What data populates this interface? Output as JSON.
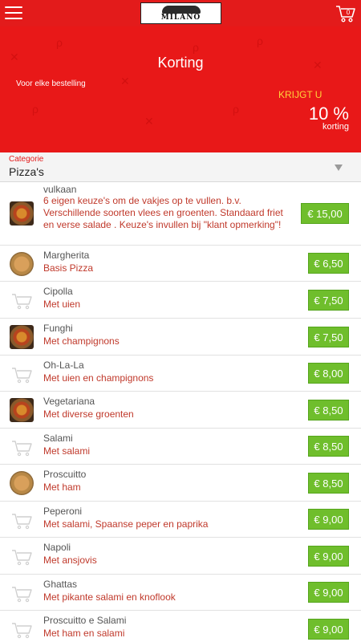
{
  "header": {
    "menu_icon": "hamburger-menu-icon",
    "logo_text": "MILANO",
    "cart_icon": "cart-icon",
    "cart_count": "0"
  },
  "banner": {
    "title": "Korting",
    "subtitle": "Voor elke bestelling",
    "krijgt": "KRIJGT U",
    "percent": "10 %",
    "korting": "korting"
  },
  "category": {
    "label": "Categorie",
    "value": "Pizza's"
  },
  "colors": {
    "brand_red": "#e31b1b",
    "price_green": "#6fbe2c",
    "desc_red": "#c0392b",
    "krijgt_yellow": "#ffd23a"
  },
  "items": [
    {
      "name": "vulkaan",
      "desc": "6 eigen keuze's om de vakjes op te vullen. b.v. Verschillende soorten vlees en groenten. Standaard friet en verse salade . Keuze's invullen bij \"klant opmerking\"!",
      "price": "€ 15,00",
      "thumb": "pizza"
    },
    {
      "name": "Margherita",
      "desc": "Basis Pizza",
      "price": "€ 6,50",
      "thumb": "marg"
    },
    {
      "name": "Cipolla",
      "desc": "Met uien",
      "price": "€ 7,50",
      "thumb": "cart"
    },
    {
      "name": "Funghi",
      "desc": "Met champignons",
      "price": "€ 7,50",
      "thumb": "pizza"
    },
    {
      "name": "Oh-La-La",
      "desc": "Met uien en champignons",
      "price": "€ 8,00",
      "thumb": "cart"
    },
    {
      "name": "Vegetariana",
      "desc": "Met diverse groenten",
      "price": "€ 8,50",
      "thumb": "pizza"
    },
    {
      "name": "Salami",
      "desc": "Met salami",
      "price": "€ 8,50",
      "thumb": "cart"
    },
    {
      "name": "Proscuitto",
      "desc": "Met ham",
      "price": "€ 8,50",
      "thumb": "marg"
    },
    {
      "name": "Peperoni",
      "desc": "Met salami, Spaanse peper en paprika",
      "price": "€ 9,00",
      "thumb": "cart"
    },
    {
      "name": "Napoli",
      "desc": "Met ansjovis",
      "price": "€ 9,00",
      "thumb": "cart"
    },
    {
      "name": "Ghattas",
      "desc": "Met pikante salami en knoflook",
      "price": "€ 9,00",
      "thumb": "cart"
    },
    {
      "name": "Proscuitto e Salami",
      "desc": "Met ham en salami",
      "price": "€ 9,00",
      "thumb": "cart"
    }
  ]
}
